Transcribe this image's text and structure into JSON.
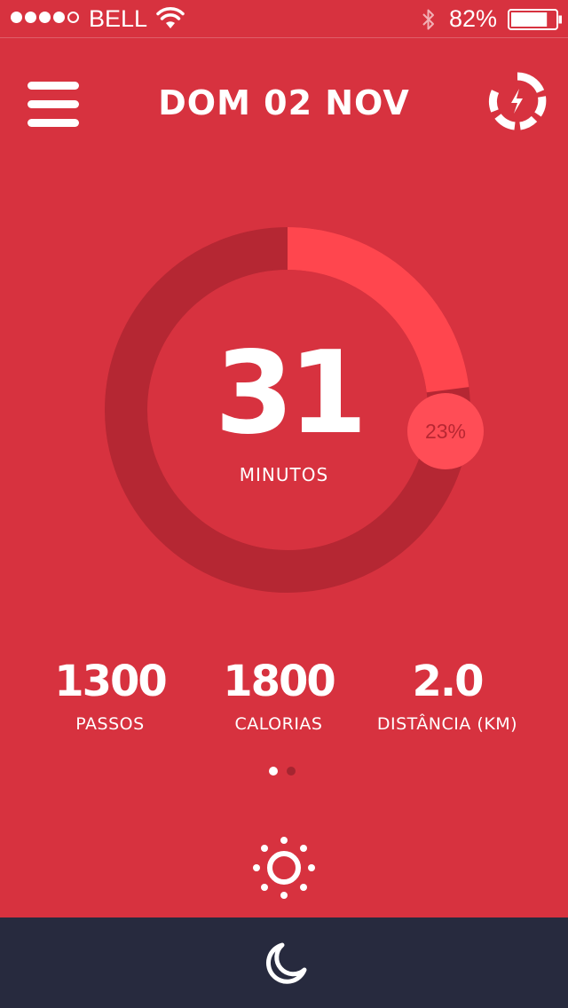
{
  "status_bar": {
    "carrier": "BELL",
    "battery_percent": "82%",
    "battery_level": 0.82,
    "signal_bars_filled": 4,
    "signal_bars_total": 5
  },
  "header": {
    "title": "DOM 02 NOV"
  },
  "activity": {
    "value": "31",
    "unit_label": "MINUTOS",
    "progress_label": "23%",
    "progress": 0.23
  },
  "stats": [
    {
      "value": "1300",
      "label": "PASSOS"
    },
    {
      "value": "1800",
      "label": "CALORIAS"
    },
    {
      "value": "2.0",
      "label": "DISTÂNCIA (KM)"
    }
  ],
  "pager": {
    "current": 1,
    "total": 2
  },
  "icons": {
    "menu": "menu-icon",
    "power": "power-icon",
    "sun": "sun-icon",
    "moon": "moon-icon",
    "wifi": "wifi-icon",
    "bluetooth": "bluetooth-icon",
    "battery": "battery-icon"
  },
  "colors": {
    "background": "#d7323f",
    "ring_track": "#b52733",
    "ring_progress": "#ff464e",
    "badge": "#ff4d56",
    "bottom_bar": "#272a3e"
  }
}
